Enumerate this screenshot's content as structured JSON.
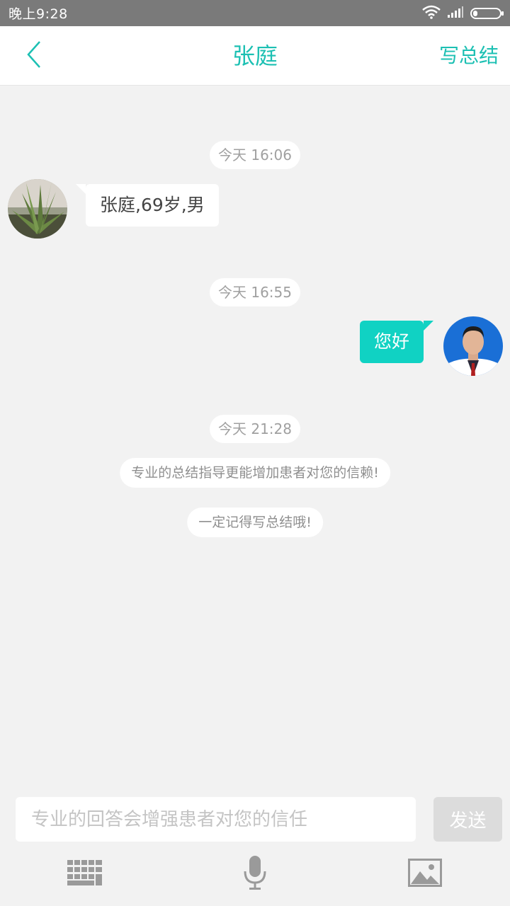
{
  "status_bar": {
    "time": "晚上9:28",
    "icons": [
      "wifi-icon",
      "signal-icon",
      "battery-icon"
    ]
  },
  "header": {
    "title": "张庭",
    "action_label": "写总结",
    "back_icon": "chevron-left-icon"
  },
  "colors": {
    "accent": "#1cc0b3",
    "bubble_self": "#10d2c3",
    "background": "#f2f2f2"
  },
  "chat": {
    "timestamps": [
      "今天 16:06",
      "今天 16:55",
      "今天 21:28"
    ],
    "patient_message": "张庭,69岁,男",
    "doctor_message": "您好",
    "notices": [
      "专业的总结指导更能增加患者对您的信赖!",
      "一定记得写总结哦!"
    ]
  },
  "input": {
    "placeholder": "专业的回答会增强患者对您的信任",
    "value": "",
    "send_label": "发送"
  },
  "toolbar": {
    "icons": [
      "keyboard-icon",
      "microphone-icon",
      "image-icon"
    ]
  }
}
